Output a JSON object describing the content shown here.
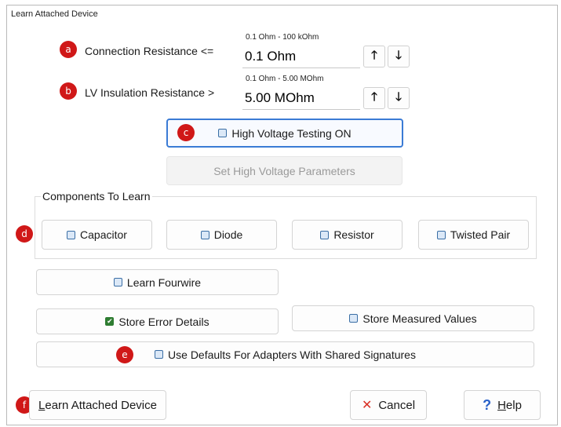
{
  "window": {
    "title": "Learn Attached Device"
  },
  "badges": {
    "a": "a",
    "b": "b",
    "c": "c",
    "d": "d",
    "e": "e",
    "f": "f"
  },
  "connection": {
    "label": "Connection Resistance <=",
    "range": "0.1 Ohm - 100 kOhm",
    "value": "0.1 Ohm"
  },
  "lv_insulation": {
    "label": "LV Insulation Resistance >",
    "range": "0.1 Ohm - 5.00 MOhm",
    "value": "5.00 MOhm"
  },
  "high_voltage": {
    "toggle_label": "High Voltage Testing ON",
    "params_label": "Set High Voltage Parameters"
  },
  "components": {
    "title": "Components To Learn",
    "items": [
      {
        "label": "Capacitor"
      },
      {
        "label": "Diode"
      },
      {
        "label": "Resistor"
      },
      {
        "label": "Twisted Pair"
      }
    ]
  },
  "options": {
    "fourwire": "Learn Fourwire",
    "store_error": "Store Error Details",
    "store_measured": "Store Measured Values",
    "use_defaults": "Use Defaults For Adapters With Shared Signatures"
  },
  "footer": {
    "learn_first": "L",
    "learn_rest": "earn Attached Device",
    "cancel": "Cancel",
    "help_first": "H",
    "help_rest": "elp"
  },
  "colors": {
    "badge": "#d01818",
    "focus": "#3a7bd5",
    "check": "#2f7d32",
    "cancel_icon": "#d93025",
    "help_icon": "#2a62c9"
  }
}
